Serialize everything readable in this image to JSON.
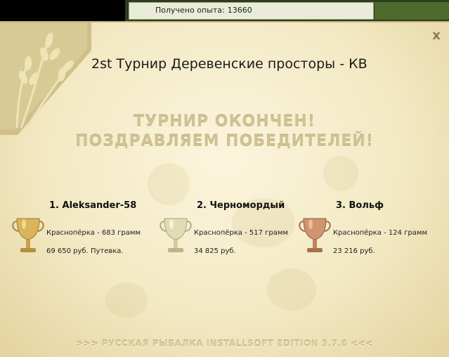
{
  "status": {
    "xp_label": "Получено опыта:",
    "xp_value": "13660"
  },
  "dialog": {
    "title": "2st Турнир Деревенские просторы - КВ",
    "headline1": "ТУРНИР ОКОНЧЕН!",
    "headline2": "ПОЗДРАВЛЯЕМ ПОБЕДИТЕЛЕЙ!",
    "close_label": "x",
    "winners": [
      {
        "name": "1. Aleksander-58",
        "fish": "Краснопёрка - 683 грамм",
        "prize": "69 650 руб. Путевка.",
        "cup": "gold-trophy-icon"
      },
      {
        "name": "2. Черномордый",
        "fish": "Краснопёрка - 517 грамм",
        "prize": "34 825 руб.",
        "cup": "silver-trophy-icon"
      },
      {
        "name": "3. Вольф",
        "fish": "Краснопёрка - 124 грамм",
        "prize": "23 216 руб.",
        "cup": "bronze-trophy-icon"
      }
    ],
    "footer": ">>> РУССКАЯ РЫБАЛКА INSTALLSOFT EDITION 3.7.6 <<<"
  },
  "colors": {
    "parchment": "#f3e9c4",
    "headline": "#cfc292",
    "gold": "#d9b45a",
    "silver": "#d8d4b0",
    "bronze": "#c98b62"
  }
}
